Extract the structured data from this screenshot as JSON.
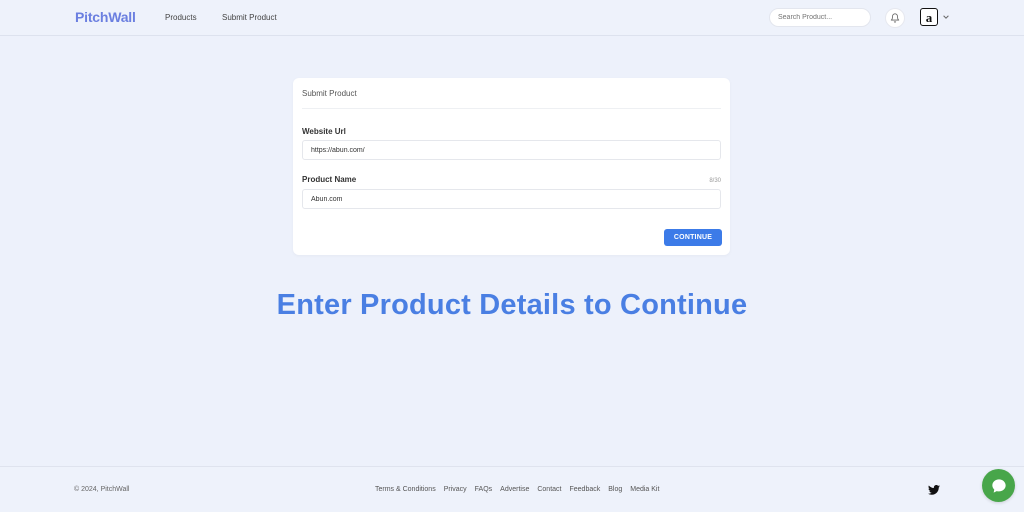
{
  "header": {
    "logo": "PitchWall",
    "nav": [
      "Products",
      "Submit Product"
    ],
    "search_placeholder": "Search Product...",
    "avatar_letter": "a"
  },
  "card": {
    "title": "Submit Product",
    "website_label": "Website Url",
    "website_value": "https://abun.com/",
    "product_label": "Product Name",
    "product_value": "Abun.com",
    "char_counter": "8/30",
    "continue_label": "CONTINUE"
  },
  "banner": "Enter Product Details to Continue",
  "footer": {
    "copyright": "© 2024, PitchWall",
    "links": [
      "Terms & Conditions",
      "Privacy",
      "FAQs",
      "Advertise",
      "Contact",
      "Feedback",
      "Blog",
      "Media Kit"
    ]
  },
  "colors": {
    "accent": "#3c7be8",
    "logo": "#6b7fe0",
    "banner": "#4a7fe3",
    "chat": "#48a64a",
    "background": "#edf1fb"
  }
}
